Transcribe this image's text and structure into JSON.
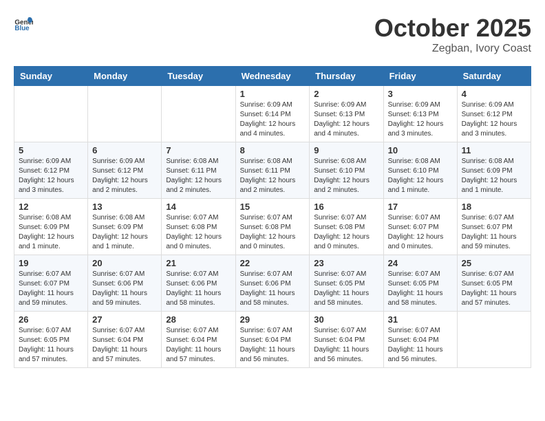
{
  "logo": {
    "text_general": "General",
    "text_blue": "Blue"
  },
  "title": "October 2025",
  "subtitle": "Zegban, Ivory Coast",
  "headers": [
    "Sunday",
    "Monday",
    "Tuesday",
    "Wednesday",
    "Thursday",
    "Friday",
    "Saturday"
  ],
  "weeks": [
    [
      {
        "day": "",
        "info": ""
      },
      {
        "day": "",
        "info": ""
      },
      {
        "day": "",
        "info": ""
      },
      {
        "day": "1",
        "info": "Sunrise: 6:09 AM\nSunset: 6:14 PM\nDaylight: 12 hours\nand 4 minutes."
      },
      {
        "day": "2",
        "info": "Sunrise: 6:09 AM\nSunset: 6:13 PM\nDaylight: 12 hours\nand 4 minutes."
      },
      {
        "day": "3",
        "info": "Sunrise: 6:09 AM\nSunset: 6:13 PM\nDaylight: 12 hours\nand 3 minutes."
      },
      {
        "day": "4",
        "info": "Sunrise: 6:09 AM\nSunset: 6:12 PM\nDaylight: 12 hours\nand 3 minutes."
      }
    ],
    [
      {
        "day": "5",
        "info": "Sunrise: 6:09 AM\nSunset: 6:12 PM\nDaylight: 12 hours\nand 3 minutes."
      },
      {
        "day": "6",
        "info": "Sunrise: 6:09 AM\nSunset: 6:12 PM\nDaylight: 12 hours\nand 2 minutes."
      },
      {
        "day": "7",
        "info": "Sunrise: 6:08 AM\nSunset: 6:11 PM\nDaylight: 12 hours\nand 2 minutes."
      },
      {
        "day": "8",
        "info": "Sunrise: 6:08 AM\nSunset: 6:11 PM\nDaylight: 12 hours\nand 2 minutes."
      },
      {
        "day": "9",
        "info": "Sunrise: 6:08 AM\nSunset: 6:10 PM\nDaylight: 12 hours\nand 2 minutes."
      },
      {
        "day": "10",
        "info": "Sunrise: 6:08 AM\nSunset: 6:10 PM\nDaylight: 12 hours\nand 1 minute."
      },
      {
        "day": "11",
        "info": "Sunrise: 6:08 AM\nSunset: 6:09 PM\nDaylight: 12 hours\nand 1 minute."
      }
    ],
    [
      {
        "day": "12",
        "info": "Sunrise: 6:08 AM\nSunset: 6:09 PM\nDaylight: 12 hours\nand 1 minute."
      },
      {
        "day": "13",
        "info": "Sunrise: 6:08 AM\nSunset: 6:09 PM\nDaylight: 12 hours\nand 1 minute."
      },
      {
        "day": "14",
        "info": "Sunrise: 6:07 AM\nSunset: 6:08 PM\nDaylight: 12 hours\nand 0 minutes."
      },
      {
        "day": "15",
        "info": "Sunrise: 6:07 AM\nSunset: 6:08 PM\nDaylight: 12 hours\nand 0 minutes."
      },
      {
        "day": "16",
        "info": "Sunrise: 6:07 AM\nSunset: 6:08 PM\nDaylight: 12 hours\nand 0 minutes."
      },
      {
        "day": "17",
        "info": "Sunrise: 6:07 AM\nSunset: 6:07 PM\nDaylight: 12 hours\nand 0 minutes."
      },
      {
        "day": "18",
        "info": "Sunrise: 6:07 AM\nSunset: 6:07 PM\nDaylight: 11 hours\nand 59 minutes."
      }
    ],
    [
      {
        "day": "19",
        "info": "Sunrise: 6:07 AM\nSunset: 6:07 PM\nDaylight: 11 hours\nand 59 minutes."
      },
      {
        "day": "20",
        "info": "Sunrise: 6:07 AM\nSunset: 6:06 PM\nDaylight: 11 hours\nand 59 minutes."
      },
      {
        "day": "21",
        "info": "Sunrise: 6:07 AM\nSunset: 6:06 PM\nDaylight: 11 hours\nand 58 minutes."
      },
      {
        "day": "22",
        "info": "Sunrise: 6:07 AM\nSunset: 6:06 PM\nDaylight: 11 hours\nand 58 minutes."
      },
      {
        "day": "23",
        "info": "Sunrise: 6:07 AM\nSunset: 6:05 PM\nDaylight: 11 hours\nand 58 minutes."
      },
      {
        "day": "24",
        "info": "Sunrise: 6:07 AM\nSunset: 6:05 PM\nDaylight: 11 hours\nand 58 minutes."
      },
      {
        "day": "25",
        "info": "Sunrise: 6:07 AM\nSunset: 6:05 PM\nDaylight: 11 hours\nand 57 minutes."
      }
    ],
    [
      {
        "day": "26",
        "info": "Sunrise: 6:07 AM\nSunset: 6:05 PM\nDaylight: 11 hours\nand 57 minutes."
      },
      {
        "day": "27",
        "info": "Sunrise: 6:07 AM\nSunset: 6:04 PM\nDaylight: 11 hours\nand 57 minutes."
      },
      {
        "day": "28",
        "info": "Sunrise: 6:07 AM\nSunset: 6:04 PM\nDaylight: 11 hours\nand 57 minutes."
      },
      {
        "day": "29",
        "info": "Sunrise: 6:07 AM\nSunset: 6:04 PM\nDaylight: 11 hours\nand 56 minutes."
      },
      {
        "day": "30",
        "info": "Sunrise: 6:07 AM\nSunset: 6:04 PM\nDaylight: 11 hours\nand 56 minutes."
      },
      {
        "day": "31",
        "info": "Sunrise: 6:07 AM\nSunset: 6:04 PM\nDaylight: 11 hours\nand 56 minutes."
      },
      {
        "day": "",
        "info": ""
      }
    ]
  ]
}
